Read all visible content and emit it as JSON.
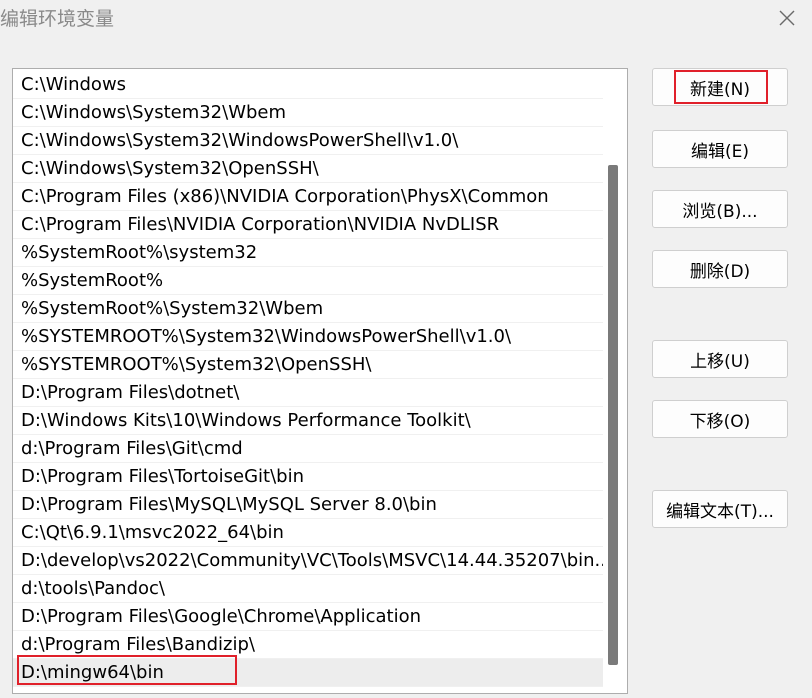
{
  "window": {
    "title": "编辑环境变量",
    "close_icon": "close-icon"
  },
  "path_list": {
    "items": [
      "C:\\Windows",
      "C:\\Windows\\System32\\Wbem",
      "C:\\Windows\\System32\\WindowsPowerShell\\v1.0\\",
      "C:\\Windows\\System32\\OpenSSH\\",
      "C:\\Program Files (x86)\\NVIDIA Corporation\\PhysX\\Common",
      "C:\\Program Files\\NVIDIA Corporation\\NVIDIA NvDLISR",
      "%SystemRoot%\\system32",
      "%SystemRoot%",
      "%SystemRoot%\\System32\\Wbem",
      "%SYSTEMROOT%\\System32\\WindowsPowerShell\\v1.0\\",
      "%SYSTEMROOT%\\System32\\OpenSSH\\",
      "D:\\Program Files\\dotnet\\",
      "D:\\Windows Kits\\10\\Windows Performance Toolkit\\",
      "d:\\Program Files\\Git\\cmd",
      "D:\\Program Files\\TortoiseGit\\bin",
      "D:\\Program Files\\MySQL\\MySQL Server 8.0\\bin",
      "C:\\Qt\\6.9.1\\msvc2022_64\\bin",
      "D:\\develop\\vs2022\\Community\\VC\\Tools\\MSVC\\14.44.35207\\bin...",
      "d:\\tools\\Pandoc\\",
      "D:\\Program Files\\Google\\Chrome\\Application",
      "d:\\Program Files\\Bandizip\\",
      "D:\\mingw64\\bin"
    ],
    "selected_index": 21
  },
  "buttons": {
    "new": "新建(N)",
    "edit": "编辑(E)",
    "browse": "浏览(B)...",
    "delete": "删除(D)",
    "move_up": "上移(U)",
    "move_down": "下移(O)",
    "edit_text": "编辑文本(T)..."
  },
  "colors": {
    "highlight": "#e0202a",
    "background": "#f0f0f0"
  }
}
